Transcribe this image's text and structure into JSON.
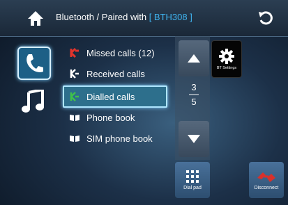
{
  "header": {
    "breadcrumb_prefix": "Bluetooth / Paired with ",
    "device_name": "[ BTH308 ]"
  },
  "sidebar": {
    "items": [
      {
        "icon": "phone-icon",
        "selected": true
      },
      {
        "icon": "music-icon",
        "selected": false
      }
    ]
  },
  "call_list": {
    "items": [
      {
        "label": "Missed calls (12)",
        "icon": "missed-call-icon",
        "icon_color": "#e0342c"
      },
      {
        "label": "Received calls",
        "icon": "received-call-icon",
        "icon_color": "#ffffff"
      },
      {
        "label": "Dialled calls",
        "icon": "dialled-call-icon",
        "icon_color": "#3fc24a",
        "selected": true
      },
      {
        "label": "Phone book",
        "icon": "phonebook-icon",
        "icon_color": "#ffffff"
      },
      {
        "label": "SIM phone book",
        "icon": "sim-phonebook-icon",
        "icon_color": "#ffffff"
      }
    ]
  },
  "pagination": {
    "current": "3",
    "total": "5"
  },
  "buttons": {
    "bt_settings": "BT Settings",
    "dial_pad": "Dial pad",
    "disconnect": "Disconnect"
  },
  "colors": {
    "accent": "#3fb4f0",
    "missed": "#e0342c",
    "dialled": "#3fc24a",
    "disconnect": "#d9302a"
  }
}
